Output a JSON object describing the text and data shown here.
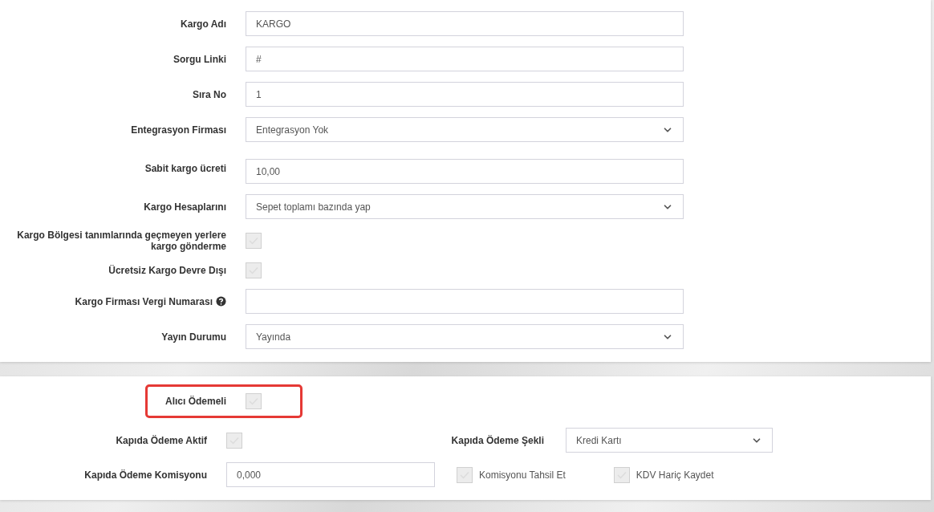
{
  "main_form": {
    "rows": [
      {
        "kind": "text",
        "label": "Kargo Adı",
        "value": "KARGO"
      },
      {
        "kind": "text",
        "label": "Sorgu Linki",
        "value": "#"
      },
      {
        "kind": "text",
        "label": "Sıra No",
        "value": "1"
      },
      {
        "kind": "select",
        "label": "Entegrasyon Firması",
        "value": "Entegrasyon Yok"
      },
      {
        "kind": "text",
        "label": "Sabit kargo ücreti",
        "value": "10,00"
      },
      {
        "kind": "select",
        "label": "Kargo Hesaplarını",
        "value": "Sepet toplamı bazında yap"
      },
      {
        "kind": "checkbox",
        "label": "Kargo Bölgesi tanımlarında geçmeyen yerlere kargo gönderme",
        "checked": false
      },
      {
        "kind": "checkbox",
        "label": "Ücretsiz Kargo Devre Dışı",
        "checked": false
      },
      {
        "kind": "text",
        "label": "Kargo Firması Vergi Numarası",
        "value": "",
        "help": true
      },
      {
        "kind": "select",
        "label": "Yayın Durumu",
        "value": "Yayında"
      }
    ]
  },
  "payment_form": {
    "buyer_pays": {
      "label": "Alıcı Ödemeli",
      "checked": false,
      "highlighted": true
    },
    "cod_active": {
      "label": "Kapıda Ödeme Aktif",
      "checked": false
    },
    "cod_method": {
      "label": "Kapıda Ödeme Şekli",
      "value": "Kredi Kartı"
    },
    "cod_commission": {
      "label": "Kapıda Ödeme Komisyonu",
      "value": "0,000"
    },
    "collect_commission": {
      "label": "Komisyonu Tahsil Et",
      "checked": false
    },
    "exclude_vat": {
      "label": "KDV Hariç Kaydet",
      "checked": false
    }
  }
}
